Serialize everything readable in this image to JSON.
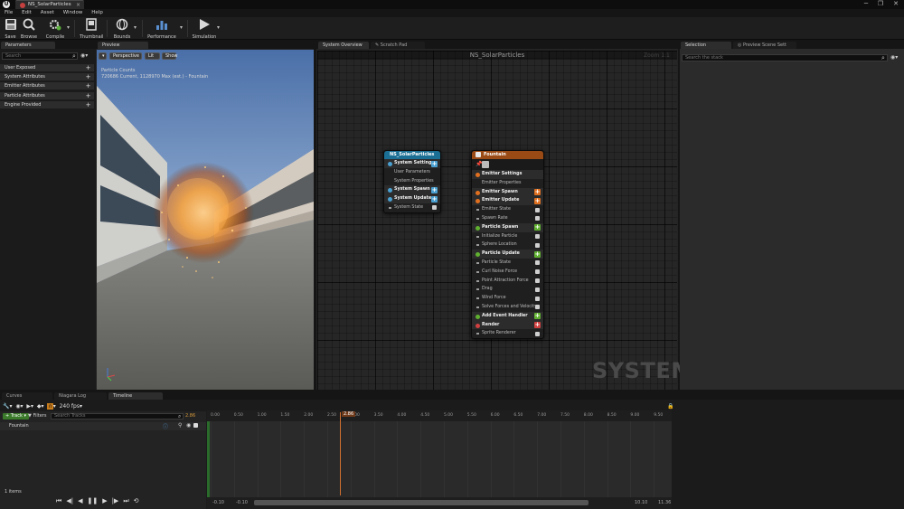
{
  "window": {
    "tab_title": "NS_SolarParticles",
    "controls": [
      "─",
      "❐",
      "✕"
    ]
  },
  "menu": [
    "File",
    "Edit",
    "Asset",
    "Window",
    "Help"
  ],
  "toolbar": {
    "buttons": [
      {
        "label": "Save",
        "icon": "save-icon"
      },
      {
        "label": "Browse",
        "icon": "browse-icon"
      },
      {
        "label": "Compile",
        "icon": "compile-icon"
      },
      {
        "label": "Thumbnail",
        "icon": "thumbnail-icon"
      },
      {
        "label": "Bounds",
        "icon": "bounds-icon"
      },
      {
        "label": "Performance",
        "icon": "performance-icon"
      },
      {
        "label": "Simulation",
        "icon": "play-icon"
      }
    ]
  },
  "parameters": {
    "tab": "Parameters",
    "search_placeholder": "Search",
    "categories": [
      "User Exposed",
      "System Attributes",
      "Emitter Attributes",
      "Particle Attributes",
      "Engine Provided"
    ]
  },
  "preview": {
    "tab": "Preview",
    "buttons": [
      "Perspective",
      "Lit",
      "Show"
    ],
    "info_line1": "Particle Counts",
    "info_line2": "720686 Current, 1128970 Max (est.) - Fountain"
  },
  "graph": {
    "tabs": [
      "System Overview",
      "Scratch Pad"
    ],
    "title": "NS_SolarParticles",
    "zoom": "Zoom 1:1",
    "watermark": "SYSTEM",
    "system_node": {
      "title": "NS_SolarParticles",
      "rows": [
        {
          "label": "System Settings",
          "type": "group",
          "color": "#4aa0d0"
        },
        {
          "label": "User Parameters",
          "type": "item"
        },
        {
          "label": "System Properties",
          "type": "item"
        },
        {
          "label": "System Spawn",
          "type": "group",
          "color": "#4aa0d0"
        },
        {
          "label": "System Update",
          "type": "group",
          "color": "#4aa0d0"
        },
        {
          "label": "System State",
          "type": "module"
        }
      ]
    },
    "emitter_node": {
      "title": "Fountain",
      "rows": [
        {
          "label": "Emitter Settings",
          "type": "group-noadd",
          "color": "#e07020"
        },
        {
          "label": "Emitter Properties",
          "type": "item"
        },
        {
          "label": "Emitter Spawn",
          "type": "group",
          "color": "#e07020"
        },
        {
          "label": "Emitter Update",
          "type": "group",
          "color": "#e07020"
        },
        {
          "label": "Emitter State",
          "type": "module"
        },
        {
          "label": "Spawn Rate",
          "type": "module"
        },
        {
          "label": "Particle Spawn",
          "type": "group",
          "color": "#60b030"
        },
        {
          "label": "Initialize Particle",
          "type": "module"
        },
        {
          "label": "Sphere Location",
          "type": "module"
        },
        {
          "label": "Particle Update",
          "type": "group",
          "color": "#60b030"
        },
        {
          "label": "Particle State",
          "type": "module"
        },
        {
          "label": "Curl Noise Force",
          "type": "module"
        },
        {
          "label": "Point Attraction Force",
          "type": "module"
        },
        {
          "label": "Drag",
          "type": "module"
        },
        {
          "label": "Wind Force",
          "type": "module"
        },
        {
          "label": "Solve Forces and Velocity",
          "type": "module"
        },
        {
          "label": "Add Event Handler",
          "type": "group",
          "color": "#60b030"
        },
        {
          "label": "Render",
          "type": "group",
          "color": "#d04040"
        },
        {
          "label": "Sprite Renderer",
          "type": "module"
        }
      ]
    }
  },
  "selection": {
    "tabs": [
      "Selection",
      "Preview Scene Sett"
    ],
    "search_placeholder": "Search the stack"
  },
  "bottom": {
    "tabs": [
      "Curves",
      "Niagara Log",
      "Timeline"
    ],
    "fps": "240 fps",
    "track_button": "Track",
    "filters_button": "Filters",
    "search_placeholder": "Search Tracks",
    "current_time": "2.86",
    "playhead_label": "2.86",
    "track_name": "Fountain",
    "items_count": "1 items",
    "ticks": [
      "0.00",
      "0.50",
      "1.00",
      "1.50",
      "2.00",
      "2.50",
      "3.00",
      "3.50",
      "4.00",
      "4.50",
      "5.00",
      "5.50",
      "6.00",
      "6.50",
      "7.00",
      "7.50",
      "8.00",
      "8.50",
      "9.00",
      "9.50"
    ],
    "range_start": "-0.10",
    "range_start2": "-0.10",
    "range_end": "10.10",
    "range_end2": "11.36"
  }
}
